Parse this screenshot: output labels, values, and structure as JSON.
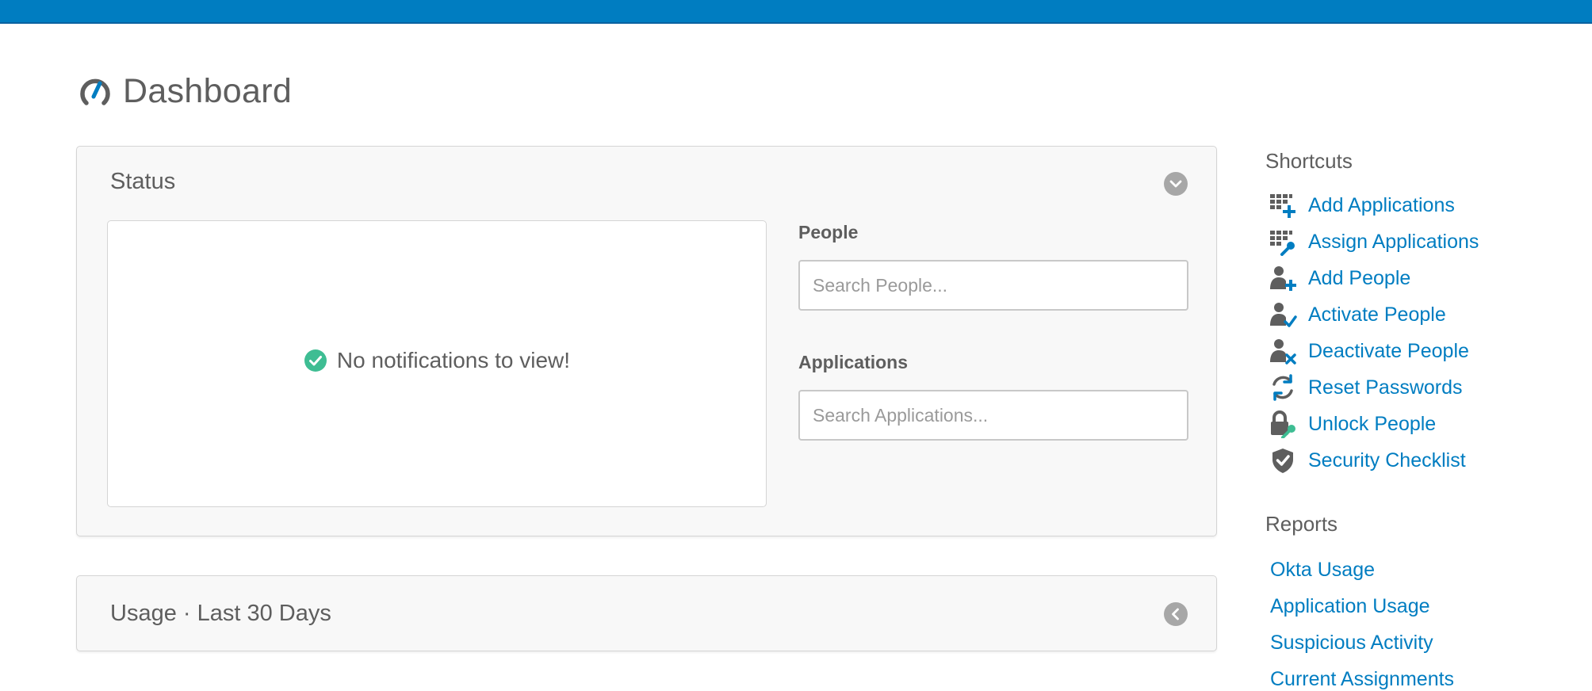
{
  "page": {
    "title": "Dashboard"
  },
  "colors": {
    "brand": "#007dc1",
    "success": "#3ebd93",
    "text": "#5e5e5e",
    "muted": "#a7a7a7"
  },
  "status_panel": {
    "title": "Status",
    "notifications_message": "No notifications to view!",
    "people": {
      "label": "People",
      "placeholder": "Search People..."
    },
    "applications": {
      "label": "Applications",
      "placeholder": "Search Applications..."
    }
  },
  "usage_panel": {
    "title": "Usage · Last 30 Days"
  },
  "shortcuts": {
    "heading": "Shortcuts",
    "items": [
      {
        "label": "Add Applications",
        "icon": "add-applications-icon"
      },
      {
        "label": "Assign Applications",
        "icon": "assign-applications-icon"
      },
      {
        "label": "Add People",
        "icon": "add-person-icon"
      },
      {
        "label": "Activate People",
        "icon": "activate-person-icon"
      },
      {
        "label": "Deactivate People",
        "icon": "deactivate-person-icon"
      },
      {
        "label": "Reset Passwords",
        "icon": "refresh-icon"
      },
      {
        "label": "Unlock People",
        "icon": "lock-key-icon"
      },
      {
        "label": "Security Checklist",
        "icon": "shield-check-icon"
      }
    ]
  },
  "reports": {
    "heading": "Reports",
    "items": [
      "Okta Usage",
      "Application Usage",
      "Suspicious Activity",
      "Current Assignments"
    ]
  }
}
